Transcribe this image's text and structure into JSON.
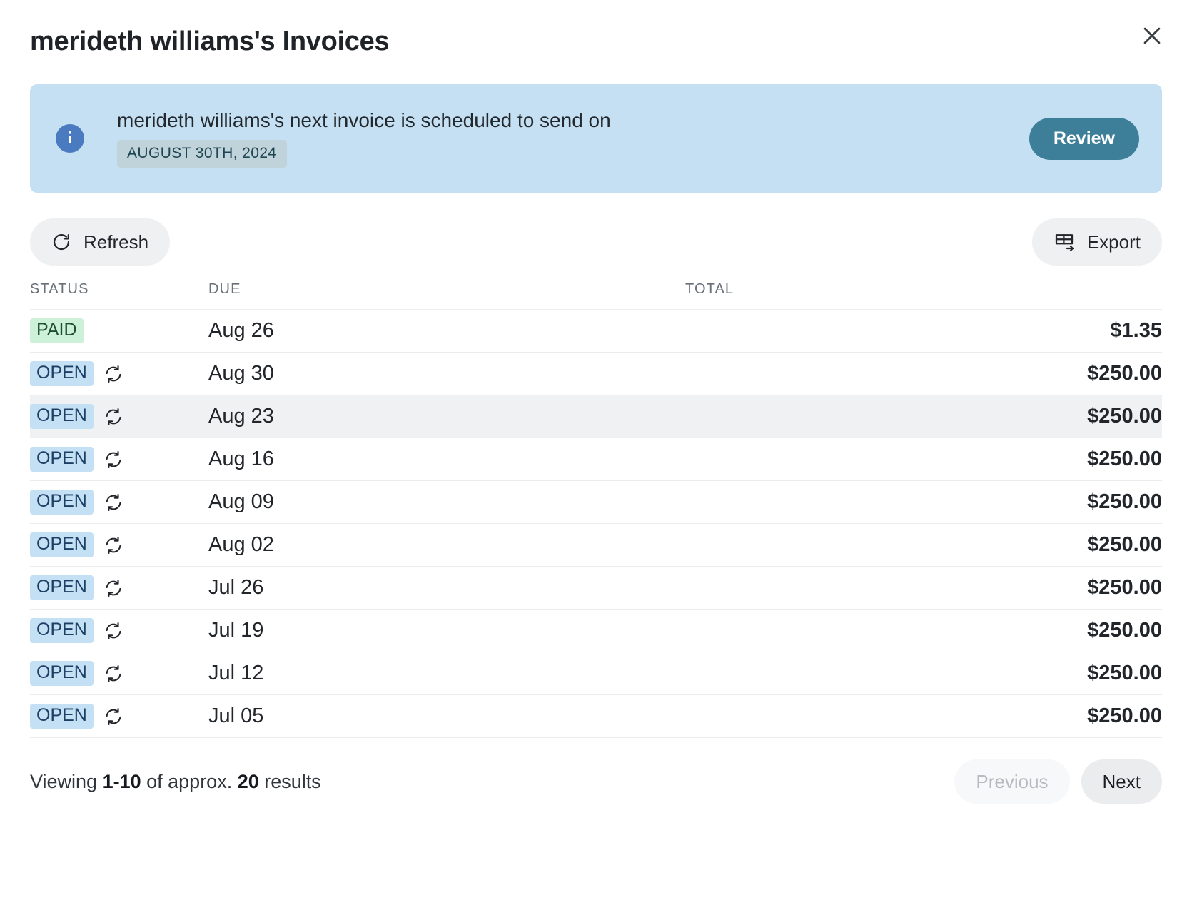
{
  "header": {
    "title": "merideth williams's Invoices",
    "close_icon": "close-icon"
  },
  "banner": {
    "icon": "info-icon",
    "message": "merideth williams's next invoice is scheduled to send on",
    "date_chip": "AUGUST 30TH, 2024",
    "review_label": "Review",
    "bg_color": "#c5e0f2",
    "review_color": "#3d7f99"
  },
  "toolbar": {
    "refresh_label": "Refresh",
    "refresh_icon": "refresh-icon",
    "export_label": "Export",
    "export_icon": "table-export-icon"
  },
  "table": {
    "columns": {
      "status": "STATUS",
      "due": "DUE",
      "total": "TOTAL"
    },
    "rows": [
      {
        "status": "PAID",
        "status_type": "paid",
        "recurring": false,
        "due": "Aug 26",
        "total": "$1.35",
        "hover": false
      },
      {
        "status": "OPEN",
        "status_type": "open",
        "recurring": true,
        "due": "Aug 30",
        "total": "$250.00",
        "hover": false
      },
      {
        "status": "OPEN",
        "status_type": "open",
        "recurring": true,
        "due": "Aug 23",
        "total": "$250.00",
        "hover": true
      },
      {
        "status": "OPEN",
        "status_type": "open",
        "recurring": true,
        "due": "Aug 16",
        "total": "$250.00",
        "hover": false
      },
      {
        "status": "OPEN",
        "status_type": "open",
        "recurring": true,
        "due": "Aug 09",
        "total": "$250.00",
        "hover": false
      },
      {
        "status": "OPEN",
        "status_type": "open",
        "recurring": true,
        "due": "Aug 02",
        "total": "$250.00",
        "hover": false
      },
      {
        "status": "OPEN",
        "status_type": "open",
        "recurring": true,
        "due": "Jul 26",
        "total": "$250.00",
        "hover": false
      },
      {
        "status": "OPEN",
        "status_type": "open",
        "recurring": true,
        "due": "Jul 19",
        "total": "$250.00",
        "hover": false
      },
      {
        "status": "OPEN",
        "status_type": "open",
        "recurring": true,
        "due": "Jul 12",
        "total": "$250.00",
        "hover": false
      },
      {
        "status": "OPEN",
        "status_type": "open",
        "recurring": true,
        "due": "Jul 05",
        "total": "$250.00",
        "hover": false
      }
    ],
    "paid_badge_color": "#cdf0d8",
    "open_badge_color": "#c3e0f5",
    "hover_row_color": "#f0f1f3"
  },
  "footer": {
    "viewing_prefix": "Viewing ",
    "viewing_range": "1-10",
    "viewing_middle": " of approx. ",
    "viewing_count": "20",
    "viewing_suffix": " results",
    "previous_label": "Previous",
    "next_label": "Next"
  }
}
